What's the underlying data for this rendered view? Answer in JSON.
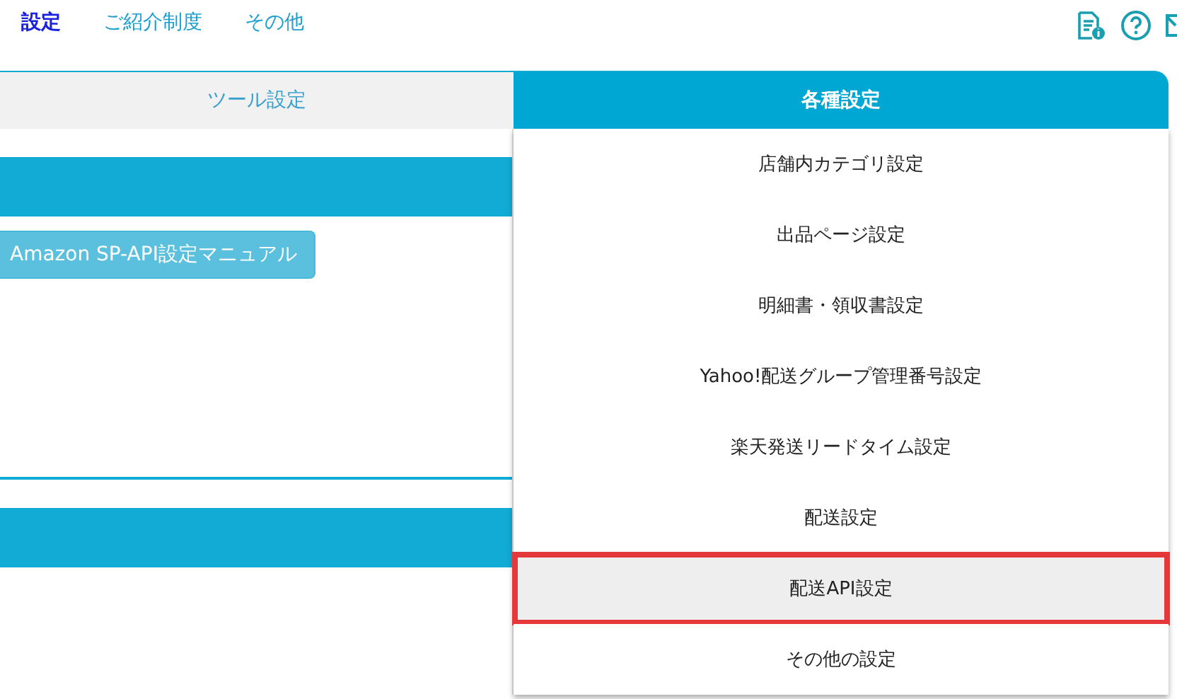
{
  "nav": [
    {
      "label": "設定",
      "selected": true
    },
    {
      "label": "ご紹介制度",
      "selected": false
    },
    {
      "label": "その他",
      "selected": false
    }
  ],
  "tabs": [
    {
      "label": "ツール設定",
      "selected": false
    },
    {
      "label": "各種設定",
      "selected": true
    }
  ],
  "manual_button": "Amazon SP-API設定マニュアル",
  "menu_items": [
    {
      "label": "店舗内カテゴリ設定",
      "highlighted": false
    },
    {
      "label": "出品ページ設定",
      "highlighted": false
    },
    {
      "label": "明細書・領収書設定",
      "highlighted": false
    },
    {
      "label": "Yahoo!配送グループ管理番号設定",
      "highlighted": false
    },
    {
      "label": "楽天発送リードタイム設定",
      "highlighted": false
    },
    {
      "label": "配送設定",
      "highlighted": false
    },
    {
      "label": "配送API設定",
      "highlighted": true
    },
    {
      "label": "その他の設定",
      "highlighted": false
    }
  ]
}
